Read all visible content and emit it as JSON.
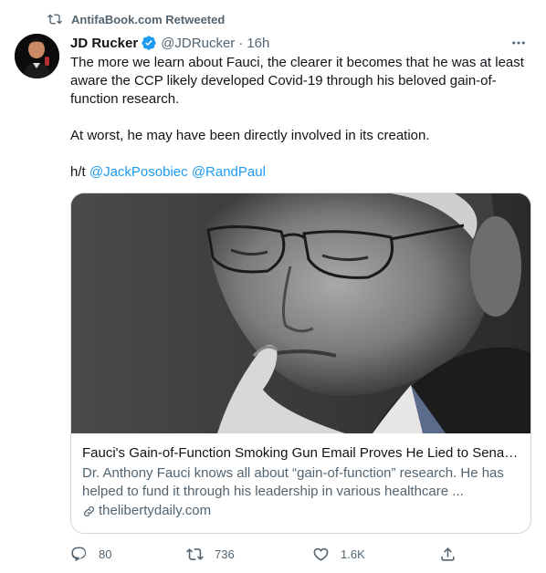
{
  "retweet": {
    "label": "AntifaBook.com Retweeted",
    "icon": "retweet-icon"
  },
  "author": {
    "display_name": "JD Rucker",
    "handle": "@JDRucker",
    "separator": "·",
    "time": "16h",
    "verified_color": "#1d9bf0"
  },
  "tweet": {
    "paragraph_1": "The more we learn about Fauci, the clearer it becomes that he was at least aware the CCP likely developed Covid-19 through his beloved gain-of-function research.",
    "paragraph_2": "At worst, he may have been directly involved in its creation.",
    "ht_prefix": "h/t",
    "mentions": [
      "@JackPosobiec",
      "@RandPaul"
    ]
  },
  "card": {
    "title": "Fauci's Gain-of-Function Smoking Gun Email Proves He Lied to Senator Rand Paul",
    "description": "Dr. Anthony Fauci knows all about “gain-of-function” research. He has helped to fund it through his leadership in various healthcare ...",
    "domain": "thelibertydaily.com"
  },
  "actions": {
    "reply_count": "80",
    "retweet_count": "736",
    "like_count": "1.6K"
  },
  "colors": {
    "accent": "#1d9bf0",
    "secondary_text": "#536471",
    "border": "#cfd9de"
  }
}
